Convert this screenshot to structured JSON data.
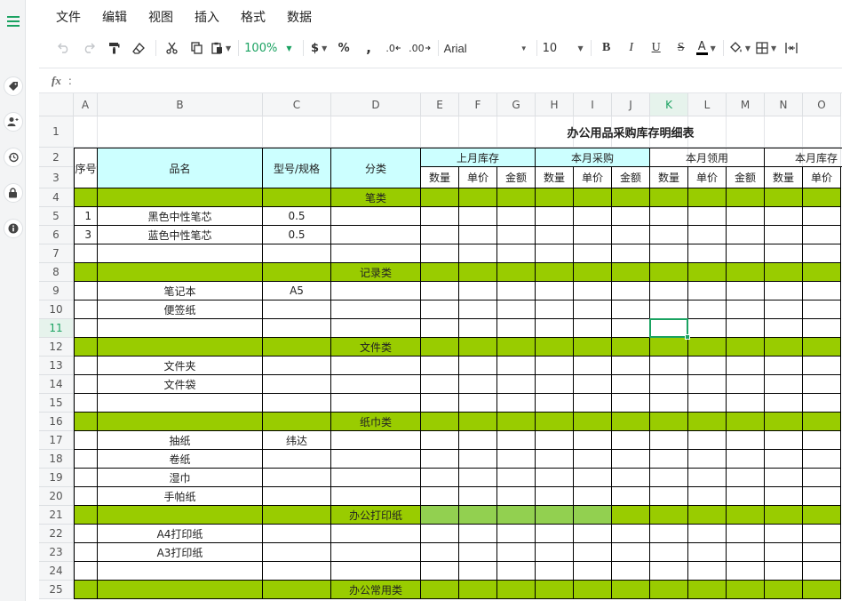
{
  "menu": [
    "文件",
    "编辑",
    "视图",
    "插入",
    "格式",
    "数据"
  ],
  "toolbar": {
    "zoom": "100%",
    "currency": "$",
    "percent": "%",
    "comma": ",",
    "dec_decrease": ".0",
    "dec_increase": ".00",
    "font": "Arial",
    "font_size": "10",
    "bold": "B",
    "italic": "I",
    "underline": "U",
    "strike": "S",
    "font_color": "A",
    "font_color_hex": "#000000"
  },
  "formula_bar": {
    "label": "fx",
    "value": ""
  },
  "colors": {
    "accent": "#1aa261",
    "section_fill": "#99cc00",
    "header_fill": "#ccffff",
    "highlight_fill": "#92d050"
  },
  "columns": [
    "A",
    "B",
    "C",
    "D",
    "E",
    "F",
    "G",
    "H",
    "I",
    "J",
    "K",
    "L",
    "M",
    "N",
    "O"
  ],
  "active_column": "K",
  "active_row": "11",
  "rows": [
    "1",
    "2",
    "3",
    "4",
    "5",
    "6",
    "7",
    "8",
    "9",
    "10",
    "11",
    "12",
    "13",
    "14",
    "15",
    "16",
    "17",
    "18",
    "19",
    "20",
    "21",
    "22",
    "23",
    "24",
    "25"
  ],
  "sheet": {
    "title": "办公用品采购库存明细表",
    "header": {
      "seq": "序号",
      "name": "品名",
      "model": "型号/规格",
      "category": "分类",
      "group_last_stock": "上月库存",
      "group_purchase": "本月采购",
      "group_usage": "本月领用",
      "group_current_stock": "本月库存",
      "qty": "数量",
      "price": "单价",
      "amount": "金额"
    },
    "sections": [
      {
        "row": "4",
        "label": "笔类"
      },
      {
        "row": "8",
        "label": "记录类"
      },
      {
        "row": "12",
        "label": "文件类"
      },
      {
        "row": "16",
        "label": "纸巾类"
      },
      {
        "row": "21",
        "label": "办公打印纸"
      },
      {
        "row": "25",
        "label": "办公常用类"
      }
    ],
    "items": [
      {
        "row": "5",
        "seq": "1",
        "name": "黑色中性笔芯",
        "model": "0.5"
      },
      {
        "row": "6",
        "seq": "3",
        "name": "蓝色中性笔芯",
        "model": "0.5"
      },
      {
        "row": "9",
        "seq": "",
        "name": "笔记本",
        "model": "A5"
      },
      {
        "row": "10",
        "seq": "",
        "name": "便签纸",
        "model": ""
      },
      {
        "row": "13",
        "seq": "",
        "name": "文件夹",
        "model": ""
      },
      {
        "row": "14",
        "seq": "",
        "name": "文件袋",
        "model": ""
      },
      {
        "row": "17",
        "seq": "",
        "name": "抽纸",
        "model": "纬达"
      },
      {
        "row": "18",
        "seq": "",
        "name": "卷纸",
        "model": ""
      },
      {
        "row": "19",
        "seq": "",
        "name": "湿巾",
        "model": ""
      },
      {
        "row": "20",
        "seq": "",
        "name": "手帕纸",
        "model": ""
      },
      {
        "row": "22",
        "seq": "",
        "name": "A4打印纸",
        "model": ""
      },
      {
        "row": "23",
        "seq": "",
        "name": "A3打印纸",
        "model": ""
      }
    ]
  }
}
